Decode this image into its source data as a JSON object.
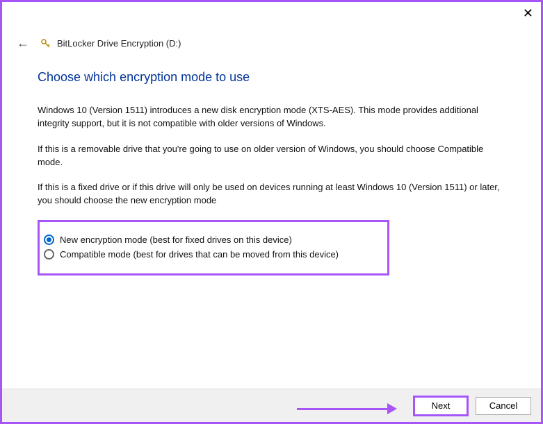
{
  "window": {
    "title": "BitLocker Drive Encryption (D:)"
  },
  "page": {
    "heading": "Choose which encryption mode to use",
    "paragraph1": "Windows 10 (Version 1511) introduces a new disk encryption mode (XTS-AES). This mode provides additional integrity support, but it is not compatible with older versions of Windows.",
    "paragraph2": "If this is a removable drive that you're going to use on older version of Windows, you should choose Compatible mode.",
    "paragraph3": "If this is a fixed drive or if this drive will only be used on devices running at least Windows 10 (Version 1511) or later, you should choose the new encryption mode"
  },
  "options": {
    "new_mode": "New encryption mode (best for fixed drives on this device)",
    "compatible_mode": "Compatible mode (best for drives that can be moved from this device)"
  },
  "buttons": {
    "next": "Next",
    "cancel": "Cancel"
  }
}
